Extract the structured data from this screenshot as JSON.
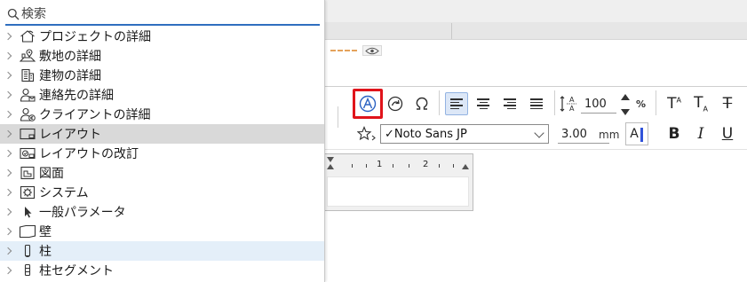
{
  "search": {
    "placeholder": "検索",
    "icon": "search-icon"
  },
  "tree": {
    "items": [
      {
        "label": "プロジェクトの詳細",
        "icon": "house-icon"
      },
      {
        "label": "敷地の詳細",
        "icon": "site-pin-icon"
      },
      {
        "label": "建物の詳細",
        "icon": "building-icon"
      },
      {
        "label": "連絡先の詳細",
        "icon": "contact-person-icon"
      },
      {
        "label": "クライアントの詳細",
        "icon": "client-icon"
      },
      {
        "label": "レイアウト",
        "icon": "layout-icon"
      },
      {
        "label": "レイアウトの改訂",
        "icon": "layout-revision-icon"
      },
      {
        "label": "図面",
        "icon": "drawing-icon"
      },
      {
        "label": "システム",
        "icon": "system-icon"
      },
      {
        "label": "一般パラメータ",
        "icon": "cursor-arrow-icon"
      },
      {
        "label": "壁",
        "icon": "wall-icon"
      },
      {
        "label": "柱",
        "icon": "column-icon"
      },
      {
        "label": "柱セグメント",
        "icon": "column-segment-icon"
      }
    ],
    "selected_index": 5,
    "hover_index": 11
  },
  "toolbar": {
    "scale_value": "100",
    "scale_unit": "%",
    "font_name": "✓Noto Sans JP",
    "font_size": "3.00",
    "font_size_unit": "mm",
    "color_button_label": "A",
    "superscript_label": "T",
    "subscript_label": "T",
    "strike_label": "T",
    "bold_label": "B",
    "italic_label": "I",
    "underline_label": "U"
  },
  "ruler": {
    "labels": [
      "1",
      "2"
    ]
  },
  "colors": {
    "accent": "#2f6fbf",
    "highlight": "#e0141b",
    "selection": "#d9d9d9",
    "hover": "#e4eff9",
    "text_color_bar": "#3153d9"
  }
}
